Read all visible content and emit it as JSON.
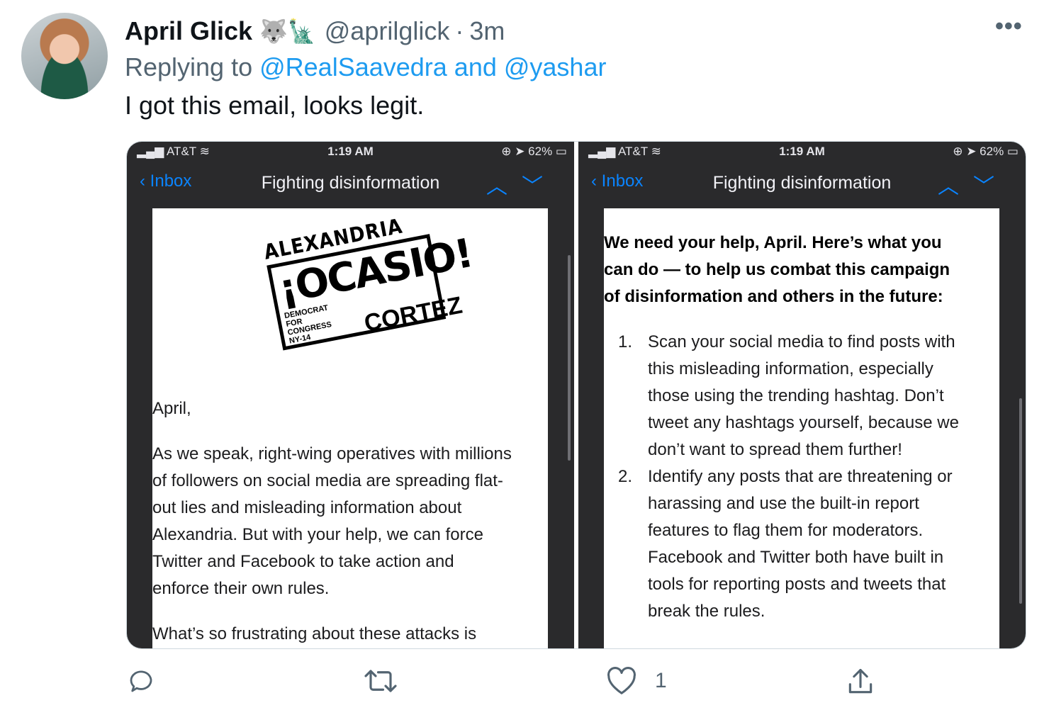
{
  "tweet": {
    "author_name": "April Glick",
    "author_emojis": "🐺🗽",
    "handle": "@aprilglick",
    "separator": "·",
    "time": "3m",
    "more_label": "•••",
    "replying_prefix": "Replying to ",
    "replying_to": "@RealSaavedra and @yashar",
    "text": "I got this email, looks legit."
  },
  "screenshots": [
    {
      "carrier": "AT&T",
      "clock": "1:19 AM",
      "battery": "62%",
      "back_label": "Inbox",
      "subject": "Fighting disinformation",
      "logo_top": "ALEXANDRIA",
      "logo_big": "¡OCASIO!",
      "logo_small": "DEMOCRAT FOR CONGRESS NY-14",
      "logo_last": "CORTEZ",
      "greeting": "April,",
      "para1_lines": [
        "As we speak, right-wing operatives with millions",
        "of followers on social media are spreading flat-",
        "out lies and misleading information about",
        "Alexandria. But with your help, we can force",
        "Twitter and Facebook to take action and",
        "enforce their own rules."
      ],
      "para2": "What’s so frustrating about these attacks is"
    },
    {
      "carrier": "AT&T",
      "clock": "1:19 AM",
      "battery": "62%",
      "back_label": "Inbox",
      "subject": "Fighting disinformation",
      "bold_lines": [
        "We need your help, April. Here’s what you",
        "can do — to help us combat this campaign",
        "of disinformation and others in the future:"
      ],
      "list": [
        {
          "num": "1.",
          "lines": [
            "Scan your social media to find posts with",
            "this misleading information, especially",
            "those using the trending hashtag. Don’t",
            "tweet any hashtags yourself, because we",
            "don’t want to spread them further!"
          ]
        },
        {
          "num": "2.",
          "lines": [
            "Identify any posts that are threatening or",
            "harassing and use the built-in report",
            "features to flag them for moderators.",
            "Facebook and Twitter both have built in",
            "tools for reporting posts and tweets that",
            "break the rules."
          ]
        }
      ]
    }
  ],
  "actions": {
    "like_count": "1"
  },
  "colors": {
    "link": "#1d9bf0",
    "secondary": "#536471",
    "ios_blue": "#0a84ff"
  }
}
